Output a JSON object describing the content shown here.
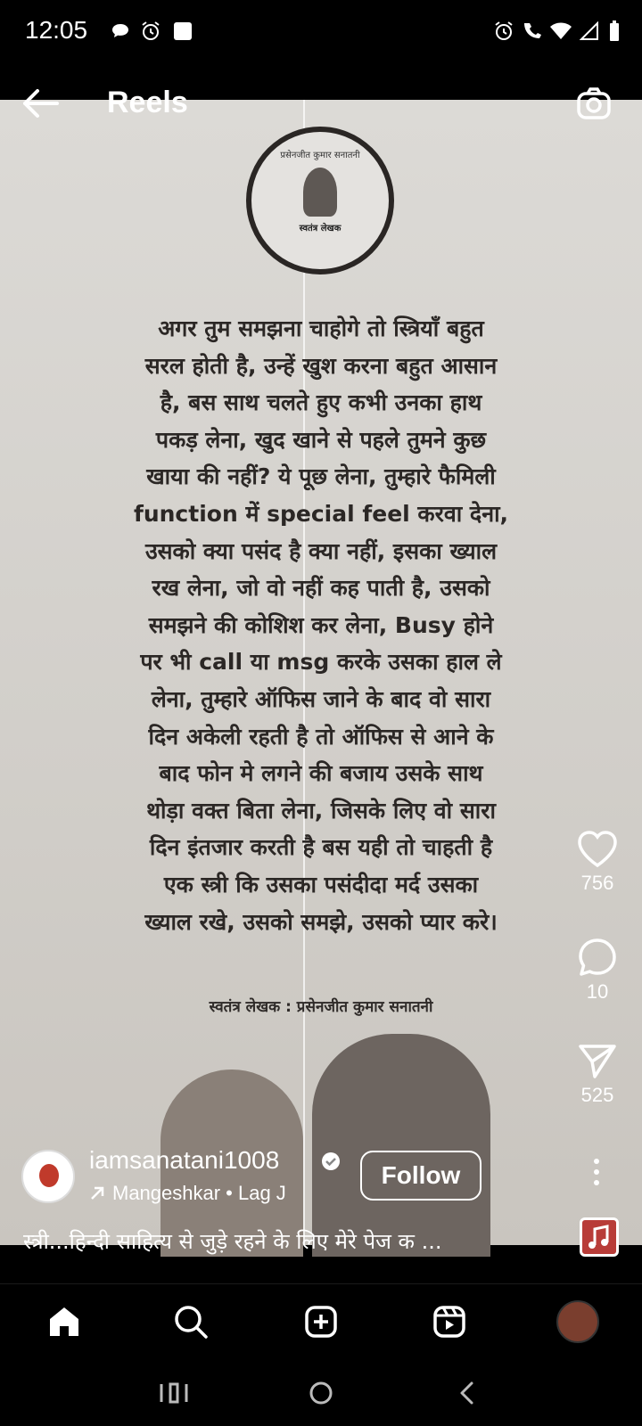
{
  "status_bar": {
    "time": "12:05"
  },
  "header": {
    "title": "Reels"
  },
  "logo": {
    "arc_text": "प्रसेनजीत कुमार सनातनी",
    "subtitle": "स्वतंत्र लेखक"
  },
  "quote": {
    "lines": [
      "अगर तुम समझना चाहोगे तो स्त्रियाँ बहुत",
      "सरल होती है, उन्हें खुश करना बहुत आसान",
      "है, बस साथ चलते हुए कभी उनका हाथ",
      "पकड़ लेना, खुद खाने से पहले तुमने कुछ",
      "खाया की नहीं? ये पूछ लेना, तुम्हारे फैमिली",
      "function में special feel करवा देना,",
      "उसको क्या पसंद है क्या नहीं, इसका ख्याल",
      "रख लेना, जो वो नहीं कह पाती है, उसको",
      "समझने की कोशिश कर लेना, Busy होने",
      "पर भी call या msg करके उसका हाल ले",
      "लेना, तुम्हारे ऑफिस जाने के बाद वो सारा",
      "दिन अकेली रहती है तो ऑफिस से आने के",
      "बाद फोन मे लगने की बजाय उसके साथ",
      "थोड़ा वक्त बिता लेना, जिसके लिए वो सारा",
      "दिन इंतजार करती है बस यही तो चाहती है",
      "एक स्त्री कि उसका पसंदीदा मर्द उसका",
      "ख्याल रखे, उसको समझे, उसको प्यार करे।"
    ],
    "author": "स्वतंत्र लेखक : प्रसेनजीत कुमार सनातनी"
  },
  "actions": {
    "likes": "756",
    "comments": "10",
    "shares": "525"
  },
  "owner": {
    "username": "iamsanatani1008",
    "audio": "Mangeshkar • Lag J",
    "follow_label": "Follow"
  },
  "caption": "स्त्री...हिन्दी साहित्य से जुड़े रहने के लिए मेरे पेज क ..."
}
